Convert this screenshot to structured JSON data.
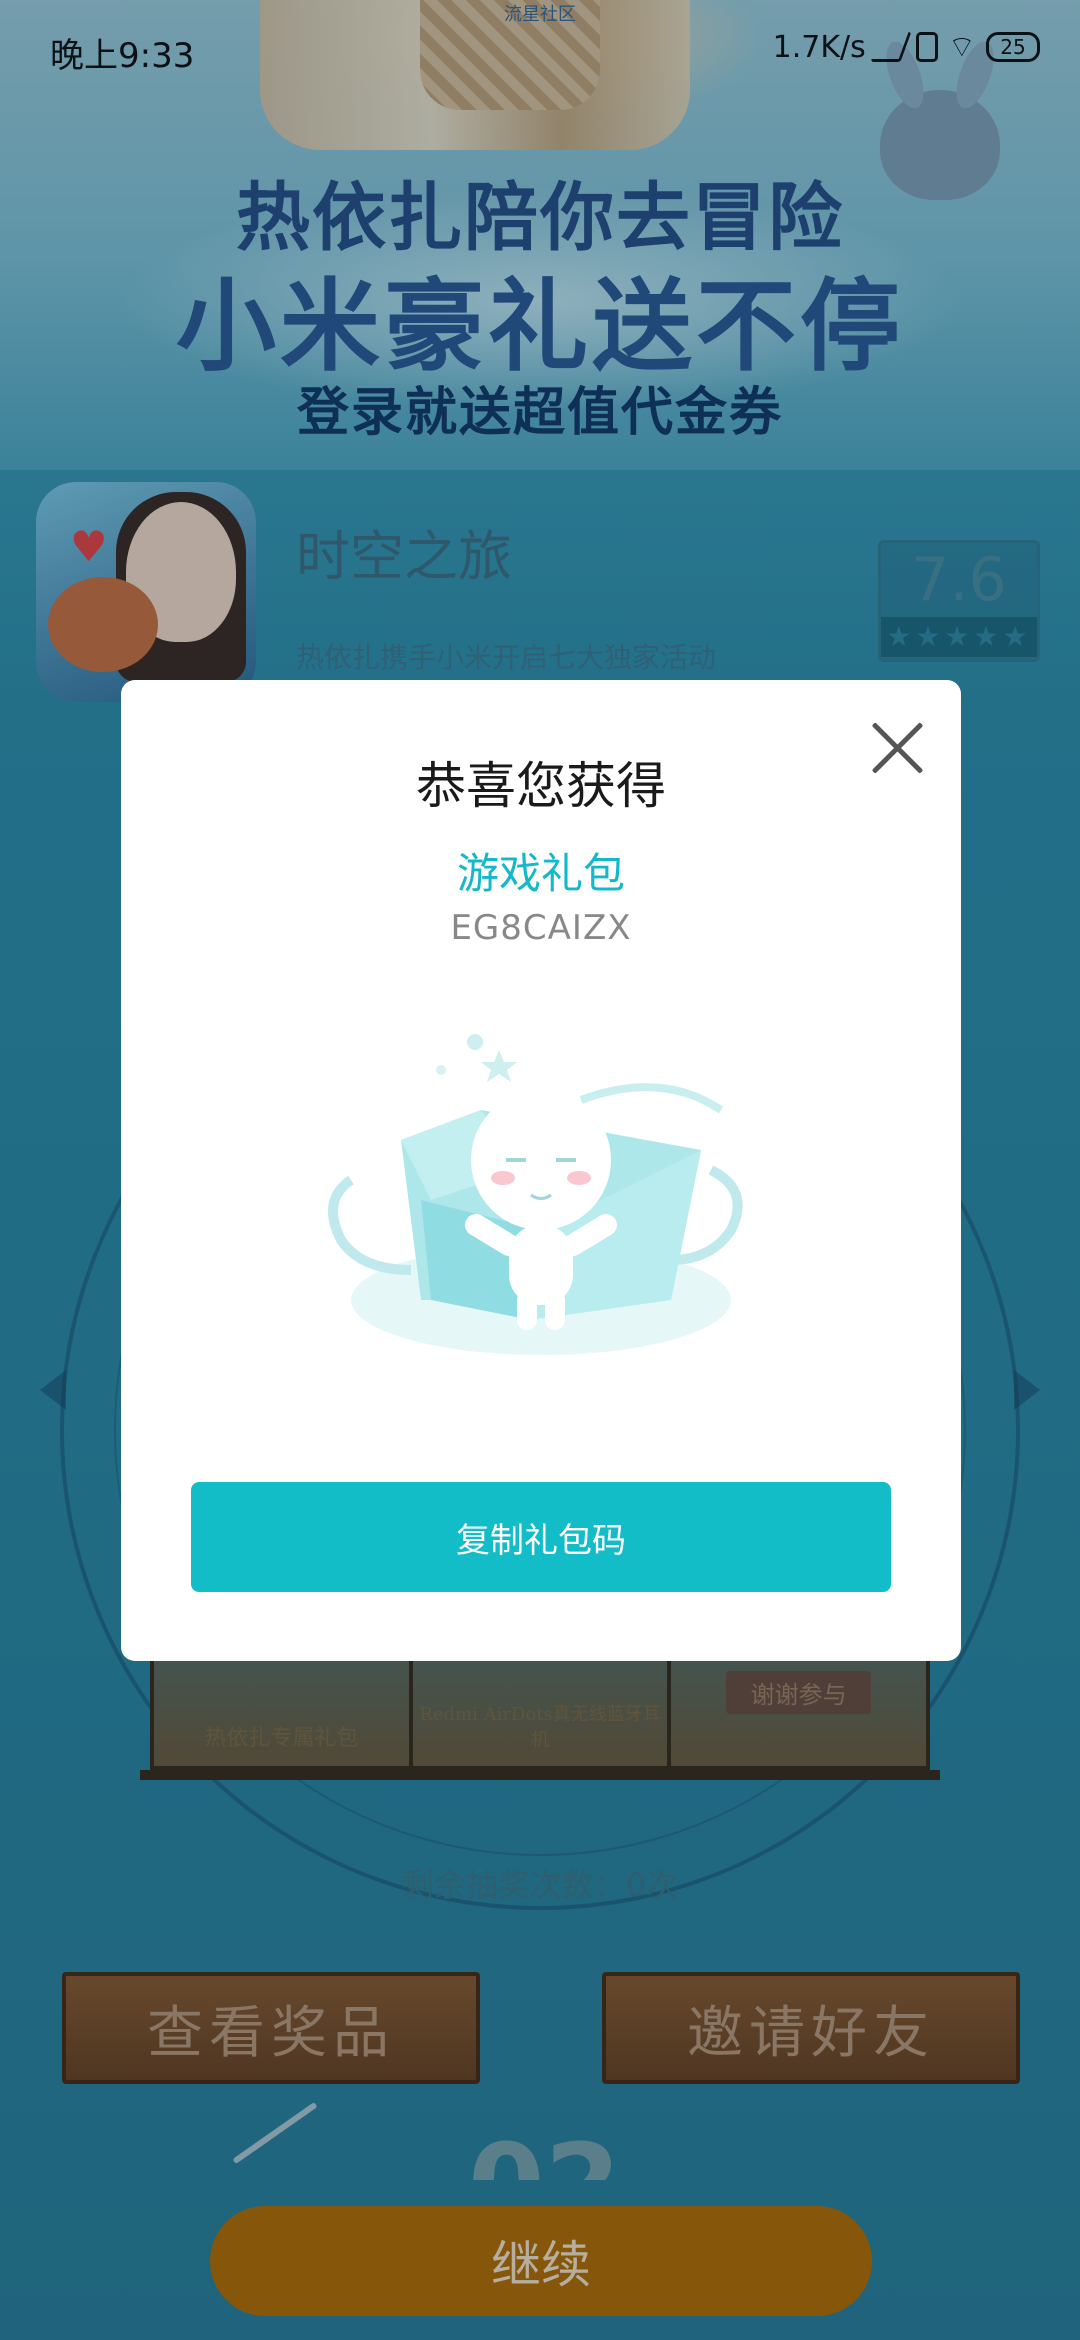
{
  "status_bar": {
    "time": "晚上9:33",
    "network_speed": "1.7K/s",
    "battery": "25"
  },
  "banner": {
    "top_label": "流星社区",
    "line1": "热依扎陪你去冒险",
    "line2": "小米豪礼送不停",
    "line3": "登录就送超值代金券"
  },
  "app": {
    "name": "时空之旅",
    "description": "热依扎携手小米开启七大独家活动",
    "rating": "7.6",
    "stars": "★★★★★"
  },
  "prizes": [
    {
      "label": "热依扎专属礼包"
    },
    {
      "label": "Redmi AirDots真无线蓝牙耳机"
    },
    {
      "label": "谢谢参与"
    }
  ],
  "lottery": {
    "remaining": "剩余抽奖次数：0次"
  },
  "buttons": {
    "view_prizes": "查看奖品",
    "invite_friends": "邀请好友",
    "continue": "继续"
  },
  "modal": {
    "title": "恭喜您获得",
    "gift_name": "游戏礼包",
    "gift_code": "EG8CAIZX",
    "copy_button": "复制礼包码"
  },
  "colors": {
    "accent": "#13bdc8",
    "continue_button": "#b36c00"
  }
}
